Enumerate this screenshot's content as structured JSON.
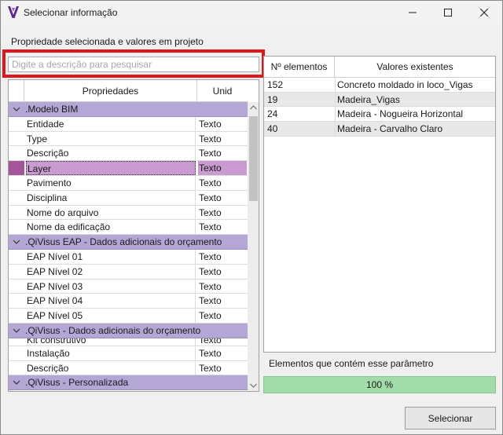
{
  "window": {
    "title": "Selecionar informação",
    "app_icon": "qivisus-v-logo-icon",
    "controls": [
      "minimize-icon",
      "maximize-icon",
      "close-icon"
    ]
  },
  "caption": "Propriedade selecionada e valores em projeto",
  "search": {
    "placeholder": "Digite a descrição para pesquisar",
    "value": ""
  },
  "properties_grid": {
    "headers": {
      "property": "Propriedades",
      "unit": "Unid"
    },
    "rows": [
      {
        "type": "group",
        "name": ".Modelo BIM"
      },
      {
        "type": "item",
        "name": "Entidade",
        "unit": "Texto"
      },
      {
        "type": "item",
        "name": "Type",
        "unit": "Texto"
      },
      {
        "type": "item",
        "name": "Descrição",
        "unit": "Texto"
      },
      {
        "type": "item",
        "name": "Layer",
        "unit": "Texto",
        "selected": true
      },
      {
        "type": "item",
        "name": "Pavimento",
        "unit": "Texto"
      },
      {
        "type": "item",
        "name": "Disciplina",
        "unit": "Texto"
      },
      {
        "type": "item",
        "name": "Nome do arquivo",
        "unit": "Texto"
      },
      {
        "type": "item",
        "name": "Nome da edificação",
        "unit": "Texto"
      },
      {
        "type": "group",
        "name": ".QiVisus EAP - Dados adicionais do orçamento"
      },
      {
        "type": "item",
        "name": "EAP Nível 01",
        "unit": "Texto"
      },
      {
        "type": "item",
        "name": "EAP Nível 02",
        "unit": "Texto"
      },
      {
        "type": "item",
        "name": "EAP Nível 03",
        "unit": "Texto"
      },
      {
        "type": "item",
        "name": "EAP Nível 04",
        "unit": "Texto"
      },
      {
        "type": "item",
        "name": "EAP Nível 05",
        "unit": "Texto"
      },
      {
        "type": "group",
        "name": ".QiVisus - Dados adicionais do orçamento"
      },
      {
        "type": "item",
        "name": "Kit construtivo",
        "unit": "Texto",
        "clipped": true
      },
      {
        "type": "item",
        "name": "Instalação",
        "unit": "Texto"
      },
      {
        "type": "item",
        "name": "Descrição",
        "unit": "Texto"
      },
      {
        "type": "group",
        "name": ".QiVisus - Personalizada"
      }
    ],
    "colors": {
      "group": "#b4a7d6",
      "selected": "#c99bd1",
      "selected_marker": "#a7559b"
    }
  },
  "values_grid": {
    "headers": {
      "count": "Nº elementos",
      "value": "Valores existentes"
    },
    "rows": [
      {
        "count": "152",
        "value": "Concreto moldado in loco_Vigas"
      },
      {
        "count": "19",
        "value": "Madeira_Vigas"
      },
      {
        "count": "24",
        "value": "Madeira - Nogueira Horizontal"
      },
      {
        "count": "40",
        "value": "Madeira - Carvalho Claro"
      }
    ]
  },
  "elements_label": "Elementos que contém esse parâmetro",
  "progress": {
    "label": "100 %",
    "fraction": 1.0,
    "color": "#9fd8a6"
  },
  "select_button": "Selecionar",
  "highlight_color": "#e0161c"
}
